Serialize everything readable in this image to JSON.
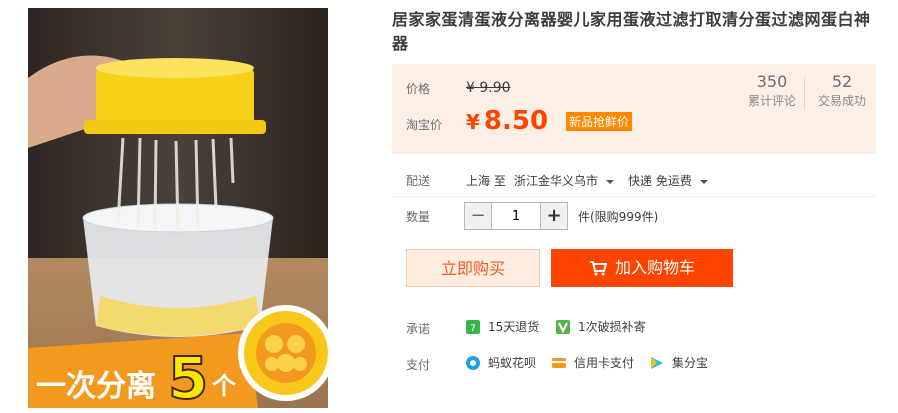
{
  "product": {
    "title": "居家家蛋清蛋液分离器婴儿家用蛋液过滤打取清分蛋过滤网蛋白神器",
    "image_caption": "一次分离",
    "image_caption_number": "5",
    "image_caption_unit": "个"
  },
  "price": {
    "original_label": "价格",
    "original_value": "¥ 9.90",
    "sale_label": "淘宝价",
    "currency": "¥",
    "sale_value": "8.50",
    "badge": "新品抢鲜价"
  },
  "stats": {
    "reviews_count": "350",
    "reviews_label": "累计评论",
    "deals_count": "52",
    "deals_label": "交易成功"
  },
  "delivery": {
    "label": "配送",
    "from": "上海 至",
    "to": "浙江金华义乌市",
    "shipping": "快递 免运费"
  },
  "quantity": {
    "label": "数量",
    "value": "1",
    "minus": "−",
    "plus": "+",
    "unit": "件(限购999件)"
  },
  "actions": {
    "buy_now": "立即购买",
    "add_to_cart": "加入购物车"
  },
  "promise": {
    "label": "承诺",
    "items": [
      "15天退货",
      "1次破损补寄"
    ]
  },
  "payment": {
    "label": "支付",
    "items": [
      "蚂蚁花呗",
      "信用卡支付",
      "集分宝"
    ]
  },
  "colors": {
    "accent": "#ff4400",
    "badge": "#ff8800",
    "price_bg": "#fcf0e6"
  },
  "icons": {
    "returns": "15-day-return-icon",
    "damage": "damage-resend-icon",
    "huabei": "huabei-icon",
    "credit_card": "credit-card-icon",
    "jifenbao": "jifenbao-icon",
    "cart": "cart-icon"
  }
}
